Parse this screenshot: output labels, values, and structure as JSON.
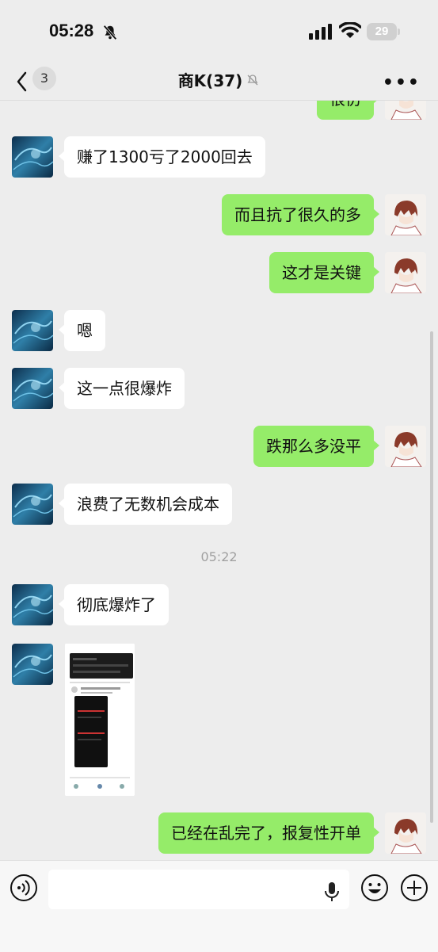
{
  "status_bar": {
    "time": "05:28",
    "battery": "29"
  },
  "nav": {
    "unread_count": "3",
    "title": "商K(37)"
  },
  "messages": [
    {
      "side": "out",
      "text": "很仿"
    },
    {
      "side": "in",
      "text": "赚了1300亏了2000回去"
    },
    {
      "side": "out",
      "text": "而且抗了很久的多"
    },
    {
      "side": "out",
      "text": "这才是关键"
    },
    {
      "side": "in",
      "text": "嗯"
    },
    {
      "side": "in",
      "text": "这一点很爆炸"
    },
    {
      "side": "out",
      "text": "跌那么多没平"
    },
    {
      "side": "in",
      "text": "浪费了无数机会成本"
    },
    {
      "side": "in",
      "text": "彻底爆炸了"
    },
    {
      "side": "out",
      "text": "已经在乱完了，报复性开单"
    }
  ],
  "timestamp": "05:22",
  "colors": {
    "outgoing_bubble": "#95ec69",
    "incoming_bubble": "#ffffff",
    "background": "#ededed"
  },
  "icons": [
    "bell-muted-icon",
    "signal-icon",
    "wifi-icon",
    "back-chevron-icon",
    "more-icon",
    "voice-icon",
    "mic-icon",
    "emoji-icon",
    "plus-icon"
  ]
}
